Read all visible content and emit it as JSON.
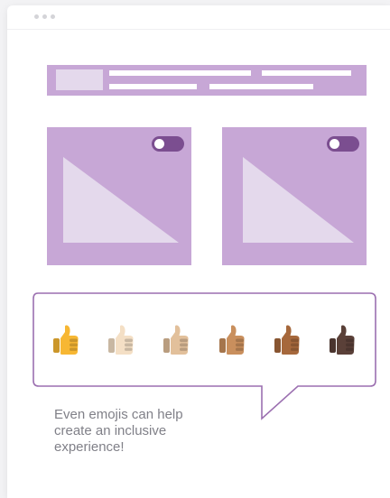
{
  "window": {
    "controls": [
      "window-dot",
      "window-dot",
      "window-dot"
    ]
  },
  "cards": [
    {
      "toggle": {
        "state": "off"
      },
      "image_placeholder": "image-placeholder-icon"
    },
    {
      "toggle": {
        "state": "off"
      },
      "image_placeholder": "image-placeholder-icon"
    }
  ],
  "emoji_picker": {
    "emojis": [
      {
        "name": "thumbs-up-default-icon",
        "skin_color": "#f7b733"
      },
      {
        "name": "thumbs-up-light-skin-icon",
        "skin_color": "#f4dfc5"
      },
      {
        "name": "thumbs-up-medium-light-skin-icon",
        "skin_color": "#e2c09b"
      },
      {
        "name": "thumbs-up-medium-skin-icon",
        "skin_color": "#c98f5d"
      },
      {
        "name": "thumbs-up-medium-dark-skin-icon",
        "skin_color": "#a6683c"
      },
      {
        "name": "thumbs-up-dark-skin-icon",
        "skin_color": "#5a4038"
      }
    ]
  },
  "caption": {
    "line1": "Even emojis can help",
    "line2": "create an inclusive",
    "line3": "experience!"
  },
  "colors": {
    "placeholder": "#c7a7d6",
    "placeholder_light": "#e4d9ec",
    "toggle": "#7b4e90",
    "bubble_border": "#9b6fb0",
    "caption_text": "#808088"
  }
}
